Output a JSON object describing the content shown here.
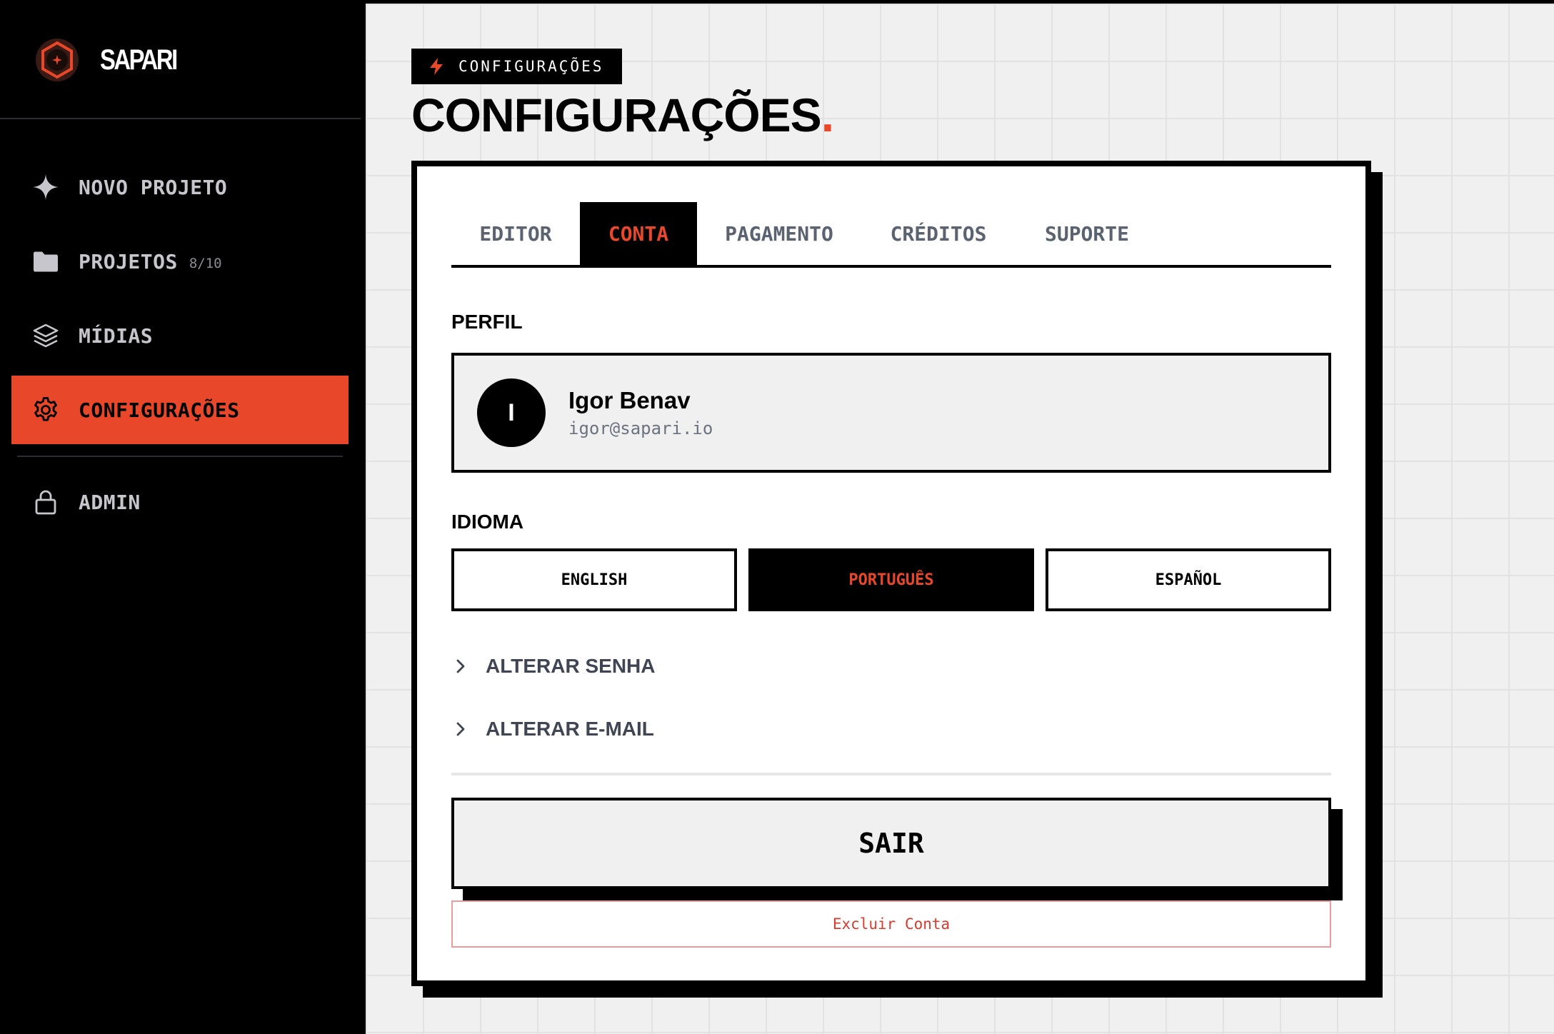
{
  "brand": {
    "name": "SAPARI",
    "logo_icon": "hexagon-star-logo"
  },
  "sidebar": {
    "items": [
      {
        "label": "NOVO PROJETO",
        "icon": "sparkle-icon"
      },
      {
        "label": "PROJETOS",
        "count": "8/10",
        "icon": "folder-icon"
      },
      {
        "label": "MÍDIAS",
        "icon": "layers-icon"
      },
      {
        "label": "CONFIGURAÇÕES",
        "icon": "gear-icon",
        "active": true
      },
      {
        "label": "ADMIN",
        "icon": "lock-icon"
      }
    ]
  },
  "header": {
    "breadcrumb": "CONFIGURAÇÕES",
    "title": "CONFIGURAÇÕES",
    "title_dot": "."
  },
  "tabs": [
    {
      "label": "EDITOR"
    },
    {
      "label": "CONTA",
      "active": true
    },
    {
      "label": "PAGAMENTO"
    },
    {
      "label": "CRÉDITOS"
    },
    {
      "label": "SUPORTE"
    }
  ],
  "profile": {
    "section_label": "PERFIL",
    "avatar_initial": "I",
    "name": "Igor Benav",
    "email": "igor@sapari.io"
  },
  "language": {
    "section_label": "IDIOMA",
    "options": [
      "ENGLISH",
      "PORTUGUÊS",
      "ESPAÑOL"
    ],
    "selected": "PORTUGUÊS"
  },
  "expanders": {
    "change_password": "ALTERAR SENHA",
    "change_email": "ALTERAR E-MAIL"
  },
  "actions": {
    "logout": "SAIR",
    "delete_account": "Excluir Conta"
  },
  "colors": {
    "accent": "#e9472a",
    "sidebar_bg": "#000000",
    "main_bg": "#f0f0f0",
    "delete_text": "#d83a2e"
  }
}
